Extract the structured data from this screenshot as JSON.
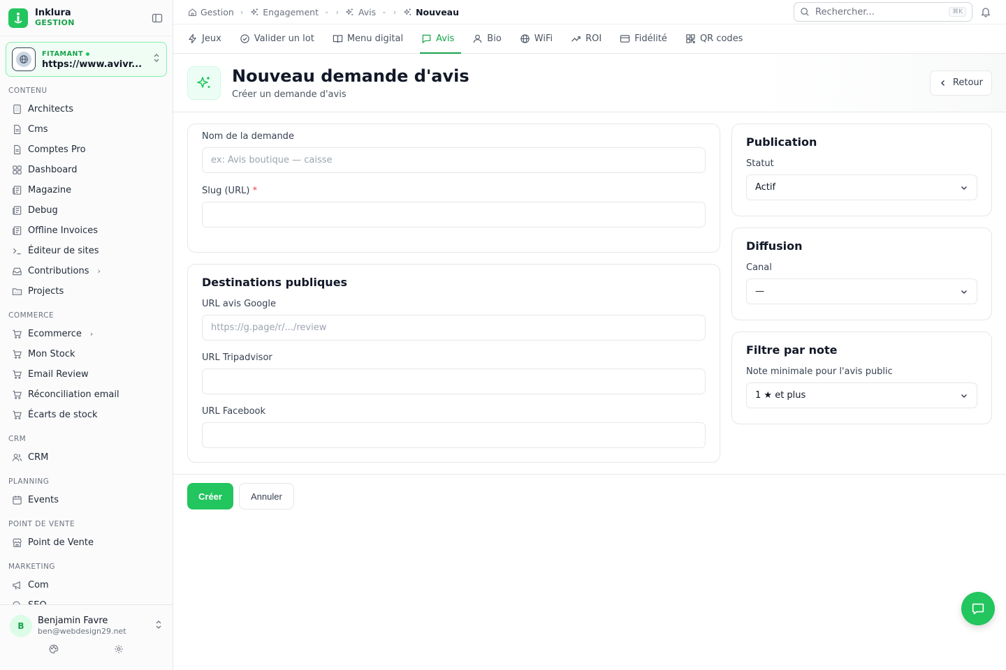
{
  "brand": {
    "name": "Inklura",
    "sub": "GESTION"
  },
  "site": {
    "label": "FITAMANT",
    "url": "https://www.avivr..."
  },
  "sidebar": {
    "sections": [
      {
        "title": "CONTENU",
        "items": [
          {
            "label": "Architects",
            "icon": "building-icon"
          },
          {
            "label": "Cms",
            "icon": "file-icon"
          },
          {
            "label": "Comptes Pro",
            "icon": "file-icon"
          },
          {
            "label": "Dashboard",
            "icon": "grid-icon"
          },
          {
            "label": "Magazine",
            "icon": "newspaper-icon"
          },
          {
            "label": "Debug",
            "icon": "newspaper-icon"
          },
          {
            "label": "Offline Invoices",
            "icon": "newspaper-icon"
          },
          {
            "label": "Éditeur de sites",
            "icon": "terminal-icon"
          },
          {
            "label": "Contributions",
            "icon": "inbox-icon",
            "arrow": "›"
          },
          {
            "label": "Projects",
            "icon": "folder-icon"
          }
        ]
      },
      {
        "title": "COMMERCE",
        "items": [
          {
            "label": "Ecommerce",
            "icon": "cart-icon",
            "arrow": "›"
          },
          {
            "label": "Mon Stock",
            "icon": "cart-icon"
          },
          {
            "label": "Email Review",
            "icon": "cart-icon"
          },
          {
            "label": "Réconciliation email",
            "icon": "cart-icon"
          },
          {
            "label": "Écarts de stock",
            "icon": "cart-icon"
          }
        ]
      },
      {
        "title": "CRM",
        "items": [
          {
            "label": "CRM",
            "icon": "users-icon"
          }
        ]
      },
      {
        "title": "PLANNING",
        "items": [
          {
            "label": "Events",
            "icon": "calendar-icon"
          }
        ]
      },
      {
        "title": "POINT DE VENTE",
        "items": [
          {
            "label": "Point de Vente",
            "icon": "store-icon"
          }
        ]
      },
      {
        "title": "MARKETING",
        "items": [
          {
            "label": "Com",
            "icon": "megaphone-icon"
          },
          {
            "label": "SEO",
            "icon": "search-icon"
          }
        ]
      }
    ]
  },
  "user": {
    "initial": "B",
    "name": "Benjamin Favre",
    "email": "ben@webdesign29.net"
  },
  "breadcrumb": [
    {
      "label": "Gestion",
      "icon": "home-icon",
      "dropdown": false
    },
    {
      "label": "Engagement",
      "icon": "sparkles-icon",
      "dropdown": true
    },
    {
      "label": "Avis",
      "icon": "sparkles-icon",
      "dropdown": true
    },
    {
      "label": "Nouveau",
      "icon": "sparkles-icon",
      "dropdown": false
    }
  ],
  "search": {
    "placeholder": "Rechercher...",
    "shortcut": "⌘K"
  },
  "tabs": [
    {
      "label": "Jeux",
      "icon": "zap-icon"
    },
    {
      "label": "Valider un lot",
      "icon": "check-circle-icon"
    },
    {
      "label": "Menu digital",
      "icon": "book-icon"
    },
    {
      "label": "Avis",
      "icon": "message-icon",
      "active": true
    },
    {
      "label": "Bio",
      "icon": "user-icon"
    },
    {
      "label": "WiFi",
      "icon": "globe-icon"
    },
    {
      "label": "ROI",
      "icon": "trending-icon"
    },
    {
      "label": "Fidélité",
      "icon": "card-icon"
    },
    {
      "label": "QR codes",
      "icon": "qr-icon"
    }
  ],
  "page": {
    "title": "Nouveau demande d'avis",
    "subtitle": "Créer un demande d'avis",
    "back_label": "Retour"
  },
  "form": {
    "name_label": "Nom de la demande",
    "name_placeholder": "ex: Avis boutique — caisse",
    "slug_label": "Slug (URL)",
    "slug_required": "*",
    "slug_value": "",
    "destinations_title": "Destinations publiques",
    "google_label": "URL avis Google",
    "google_placeholder": "https://g.page/r/.../review",
    "tripadvisor_label": "URL Tripadvisor",
    "tripadvisor_value": "",
    "facebook_label": "URL Facebook",
    "facebook_value": ""
  },
  "publication": {
    "title": "Publication",
    "status_label": "Statut",
    "status_value": "Actif"
  },
  "diffusion": {
    "title": "Diffusion",
    "canal_label": "Canal",
    "canal_value": "—"
  },
  "rating_filter": {
    "title": "Filtre par note",
    "min_label": "Note minimale pour l'avis public",
    "min_value": "1 ★ et plus"
  },
  "actions": {
    "create_label": "Créer",
    "cancel_label": "Annuler"
  },
  "colors": {
    "accent": "#22c55e",
    "accent_dark": "#16a34a"
  }
}
